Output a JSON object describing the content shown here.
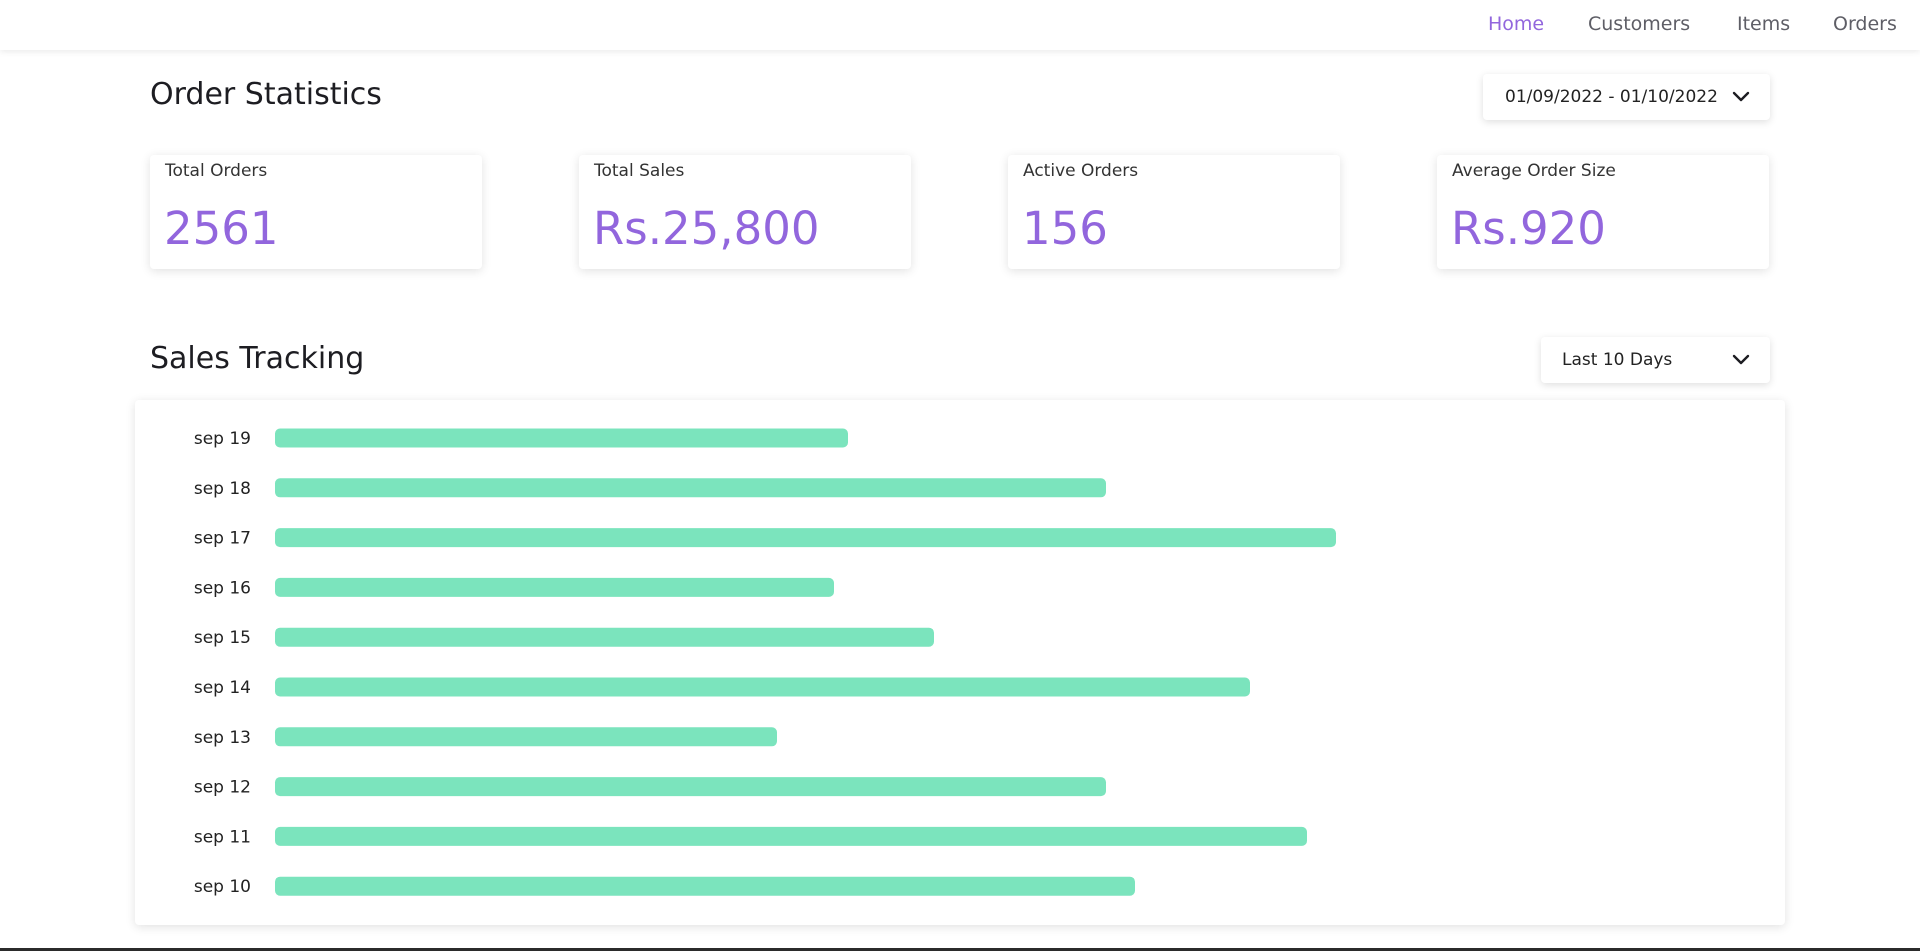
{
  "nav": {
    "items": [
      {
        "label": "Home",
        "active": true
      },
      {
        "label": "Customers",
        "active": false
      },
      {
        "label": "Items",
        "active": false
      },
      {
        "label": "Orders",
        "active": false
      }
    ]
  },
  "order_statistics": {
    "title": "Order Statistics",
    "date_range": "01/09/2022 - 01/10/2022",
    "cards": [
      {
        "label": "Total Orders",
        "value": "2561"
      },
      {
        "label": "Total Sales",
        "value": "Rs.25,800"
      },
      {
        "label": "Active Orders",
        "value": "156"
      },
      {
        "label": "Average Order Size",
        "value": "Rs.920"
      }
    ]
  },
  "sales_tracking": {
    "title": "Sales Tracking",
    "range_selected": "Last 10 Days"
  },
  "colors": {
    "accent": "#9266dd",
    "bar": "#7be4bd",
    "nav_text": "#5e5e66"
  },
  "icons": {
    "dropdown": "chevron-down-icon"
  },
  "chart_data": {
    "type": "bar",
    "orientation": "horizontal",
    "categories": [
      "sep 19",
      "sep 18",
      "sep 17",
      "sep 16",
      "sep 15",
      "sep 14",
      "sep 13",
      "sep 12",
      "sep 11",
      "sep 10"
    ],
    "values": [
      573,
      831,
      1061,
      559,
      659,
      975,
      502,
      831,
      1032,
      860
    ],
    "xlim": [
      0,
      1500
    ],
    "grid": false,
    "color": "#7be4bd"
  }
}
